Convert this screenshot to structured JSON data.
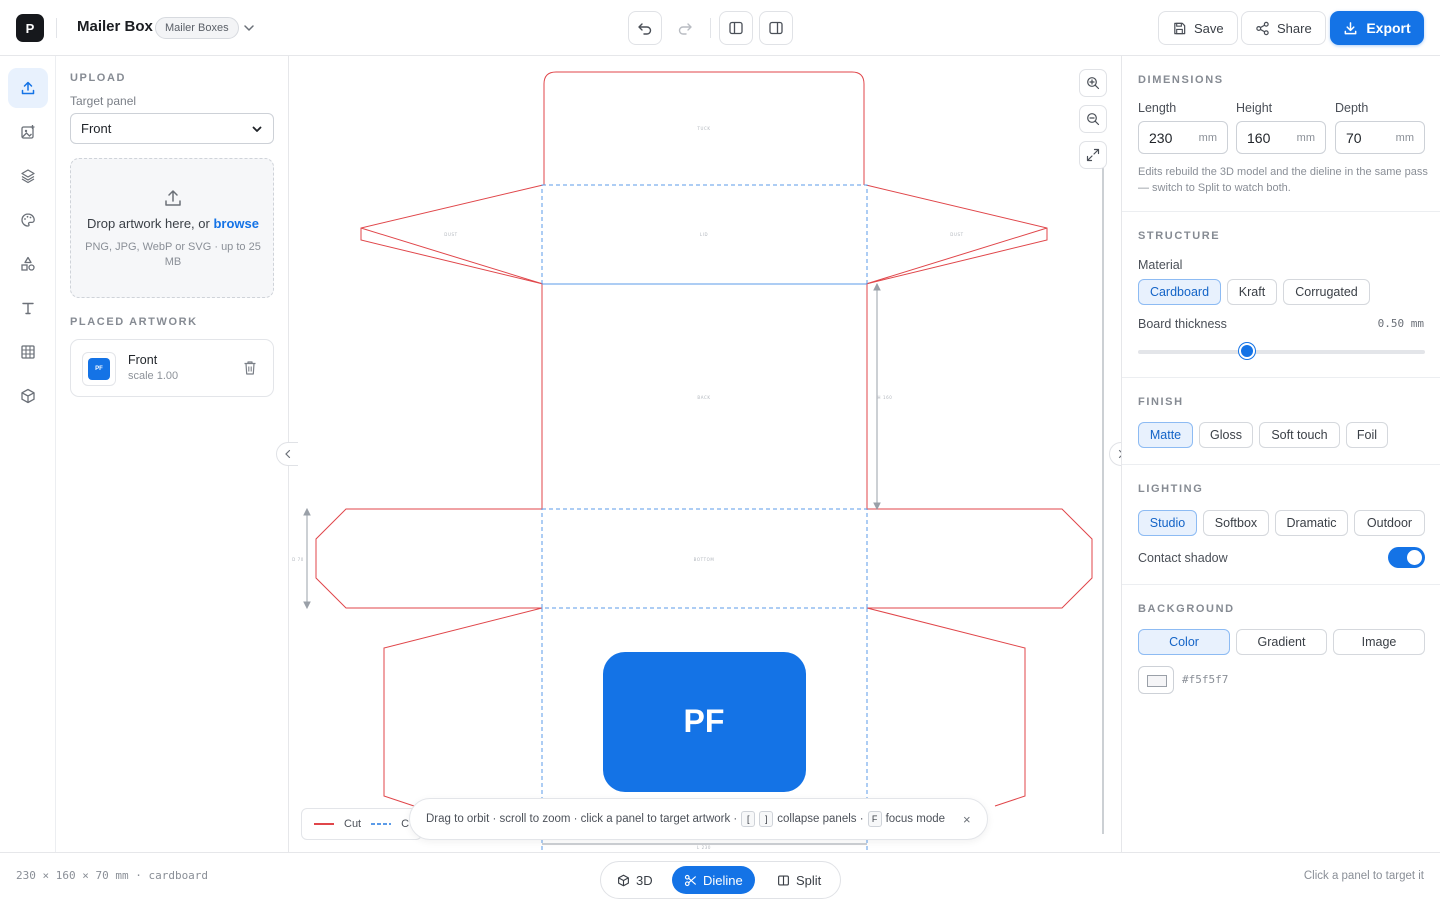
{
  "header": {
    "logo_letter": "P",
    "doc_title": "Mailer Box",
    "category_chip": "Mailer Boxes",
    "save_label": "Save",
    "share_label": "Share",
    "export_label": "Export"
  },
  "left_panel": {
    "upload_title": "UPLOAD",
    "target_label": "Target panel",
    "target_value": "Front",
    "drop_text": "Drop artwork here, or",
    "drop_link": "browse",
    "drop_formats": "PNG, JPG, WebP or SVG · up to 25 MB",
    "placed_title": "PLACED ARTWORK",
    "placed_item": {
      "name": "Front",
      "scale": "scale 1.00",
      "thumb_text": "PF"
    }
  },
  "canvas": {
    "panel_labels": {
      "tuck": "TUCK",
      "lid": "LID",
      "dust_left": "DUST",
      "dust_right": "DUST",
      "back": "BACK",
      "bottom": "BOTTOM"
    },
    "dim_labels": {
      "height": "H 160",
      "depth": "D 70",
      "length": "L 230"
    },
    "artwork_text": "PF",
    "legend": {
      "cut_label": "Cut",
      "crease_label": "C"
    },
    "toast": {
      "part1": "Drag to orbit · scroll to zoom · click a panel to target artwork ·",
      "key1": "[",
      "key2": "]",
      "part2": "collapse panels ·",
      "key3": "F",
      "part3": "focus mode",
      "close": "×"
    }
  },
  "right_panel": {
    "dimensions_title": "DIMENSIONS",
    "length_label": "Length",
    "length_value": "230",
    "height_label": "Height",
    "height_value": "160",
    "depth_label": "Depth",
    "depth_value": "70",
    "unit": "mm",
    "dim_hint": "Edits rebuild the 3D model and the dieline in the same pass — switch to Split to watch both.",
    "structure_title": "STRUCTURE",
    "material_label": "Material",
    "materials": [
      "Cardboard",
      "Kraft",
      "Corrugated"
    ],
    "selected_material": "Cardboard",
    "thickness_label": "Board thickness",
    "thickness_value": "0.50 mm",
    "thickness_fraction": 0.38,
    "finish_title": "FINISH",
    "finishes": [
      "Matte",
      "Gloss",
      "Soft touch",
      "Foil"
    ],
    "selected_finish": "Matte",
    "lighting_title": "LIGHTING",
    "lightings": [
      "Studio",
      "Softbox",
      "Dramatic",
      "Outdoor"
    ],
    "selected_lighting": "Studio",
    "shadow_label": "Contact shadow",
    "shadow_on": true,
    "background_title": "BACKGROUND",
    "backgrounds": [
      "Color",
      "Gradient",
      "Image"
    ],
    "selected_background": "Color",
    "bg_hex": "#f5f5f7"
  },
  "footer": {
    "dims_text": "230 × 160 × 70 mm · cardboard",
    "view_3d": "3D",
    "view_dieline": "Dieline",
    "view_split": "Split",
    "active_view": "Dieline",
    "hint": "Click a panel to target it"
  },
  "colors": {
    "accent": "#1473e6",
    "cut_line": "#e0464a",
    "crease_line": "#5b9be8"
  }
}
